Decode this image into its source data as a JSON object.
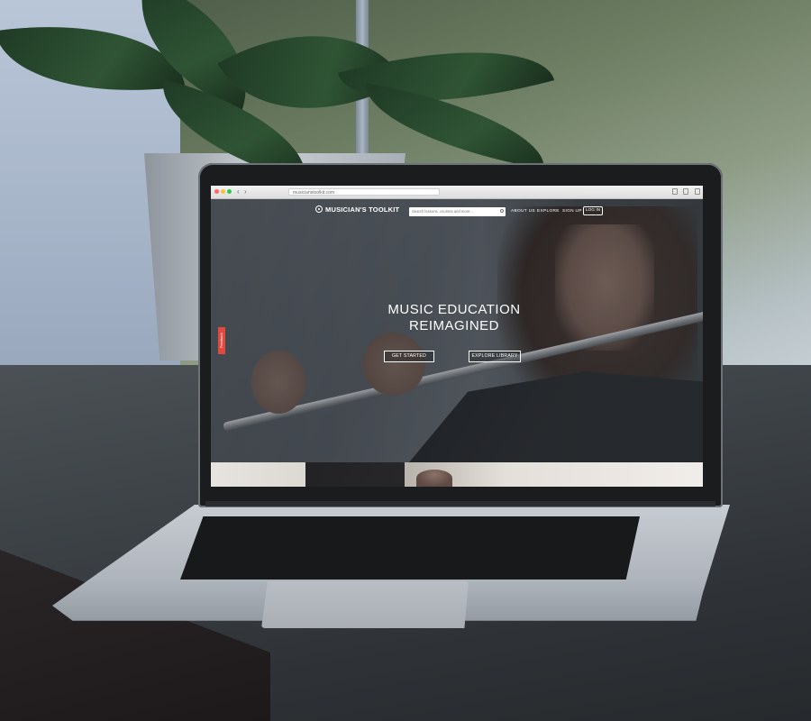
{
  "browser": {
    "url": "musicianstoolkit.com",
    "back_icon": "chevron-left-icon",
    "forward_icon": "chevron-right-icon",
    "traffic_lights": [
      "#ff5f57",
      "#febc2e",
      "#28c840"
    ]
  },
  "site": {
    "logo_text": "MUSICIAN'S TOOLKIT",
    "search_placeholder": "Search lessons, courses and more...",
    "nav": {
      "about": "ABOUT US",
      "explore": "EXPLORE",
      "signup": "SIGN UP",
      "login": "LOG IN"
    },
    "hero": {
      "title_line1": "MUSIC EDUCATION",
      "title_line2": "REIMAGINED",
      "get_started": "GET STARTED",
      "explore_library": "EXPLORE LIBRARY"
    },
    "feedback_label": "Feedback",
    "colors": {
      "feedback_tab": "#e1443a",
      "nav_text": "#ffffff"
    }
  }
}
